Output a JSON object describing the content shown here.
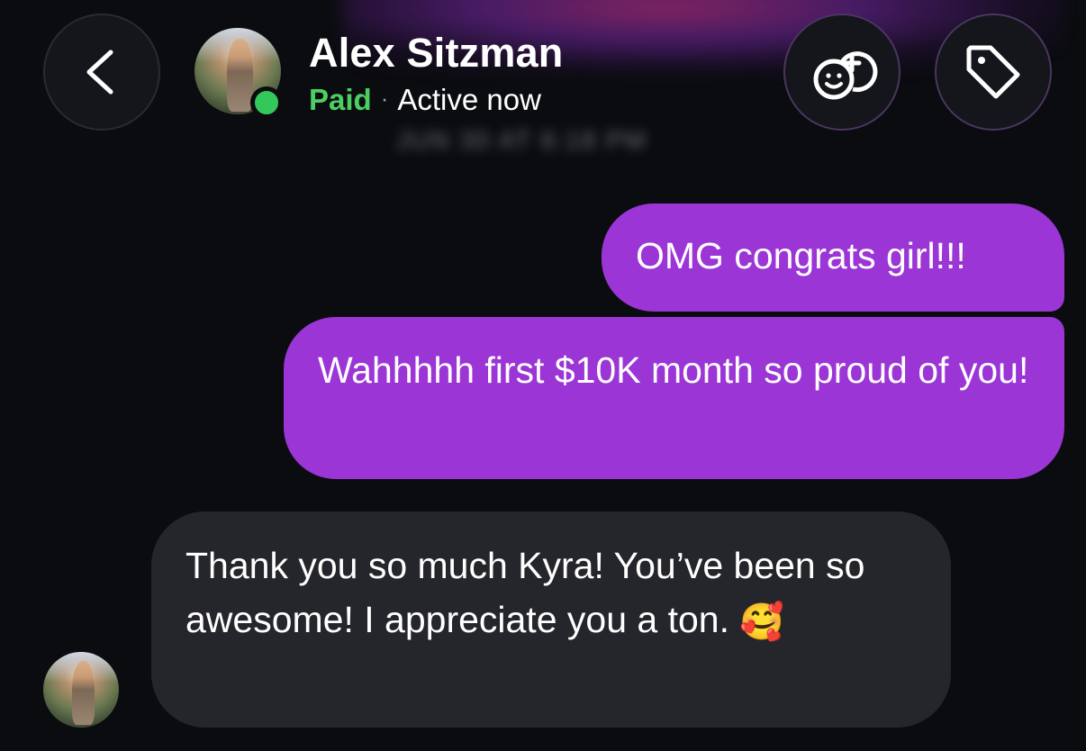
{
  "header": {
    "contact_name": "Alex Sitzman",
    "badge": "Paid",
    "separator": "·",
    "presence": "Active now",
    "back_icon": "chevron-left-icon",
    "gift_icon": "gift-emoji-add-icon",
    "tag_icon": "tag-icon",
    "online": true
  },
  "conversation": {
    "timestamp": "JUN 30 AT 6:18 PM",
    "messages": [
      {
        "direction": "sent",
        "text": "OMG congrats girl!!!"
      },
      {
        "direction": "sent",
        "text": "Wahhhhh first $10K month so proud of you!"
      },
      {
        "direction": "received",
        "text": "Thank you so much Kyra! You’ve been so awesome! I appreciate you a ton.",
        "emoji": "🥰"
      }
    ]
  },
  "colors": {
    "background": "#0b0c10",
    "sent_bubble": "#9b35d6",
    "received_bubble": "#25262b",
    "paid": "#4ccf62",
    "online": "#34c759"
  }
}
